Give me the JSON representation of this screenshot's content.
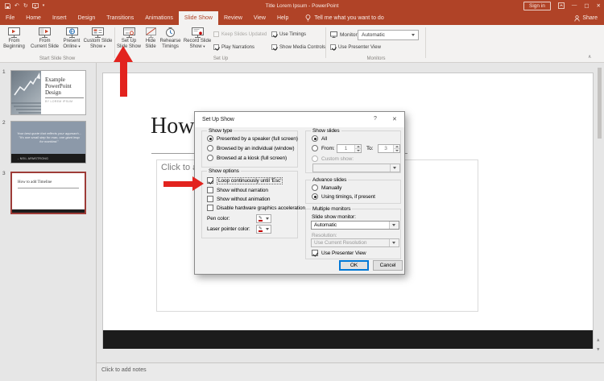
{
  "colors": {
    "brand": "#B04327",
    "annotation_arrow": "#E2231E",
    "focus_blue": "#0078D7",
    "selected_thumb_border": "#9E3C38"
  },
  "icons": {
    "dropdown_caret": "▾",
    "undo": "↶",
    "redo": "↻",
    "collapse_ribbon": "∧",
    "minimize": "—",
    "maximize": "□",
    "close": "✕",
    "pen": "✎",
    "scroll_up": "▲",
    "scroll_down": "▼"
  },
  "titlebar": {
    "title": "Title Lorem Ipsum  -  PowerPoint",
    "sign_in_label": "Sign in"
  },
  "menubar": {
    "tabs": [
      "File",
      "Home",
      "Insert",
      "Design",
      "Transitions",
      "Animations",
      "Slide Show",
      "Review",
      "View",
      "Help"
    ],
    "active_tab": "Slide Show",
    "tell_me": "Tell me what you want to do",
    "share_label": "Share"
  },
  "ribbon": {
    "start_group": {
      "label": "Start Slide Show",
      "from_beginning": {
        "line1": "From",
        "line2": "Beginning"
      },
      "from_current": {
        "line1": "From",
        "line2": "Current Slide"
      },
      "present_online": {
        "line1": "Present",
        "line2": "Online"
      },
      "custom_show": {
        "line1": "Custom Slide",
        "line2": "Show"
      }
    },
    "setup_group": {
      "label": "Set Up",
      "setup_slideshow": {
        "line1": "Set Up",
        "line2": "Slide Show"
      },
      "hide_slide": {
        "line1": "Hide",
        "line2": "Slide"
      },
      "rehearse": {
        "line1": "Rehearse",
        "line2": "Timings"
      },
      "record": {
        "line1": "Record Slide",
        "line2": "Show"
      },
      "checkboxes": [
        {
          "label": "Keep Slides Updated",
          "checked": false,
          "disabled": true
        },
        {
          "label": "Play Narrations",
          "checked": true,
          "disabled": false
        },
        {
          "label": "Use Timings",
          "checked": true,
          "disabled": false
        },
        {
          "label": "Show Media Controls",
          "checked": true,
          "disabled": false
        }
      ]
    },
    "monitors_group": {
      "label": "Monitors",
      "monitor_label": "Monitor:",
      "monitor_value": "Automatic",
      "use_presenter_view": "Use Presenter View",
      "presenter_checked": true
    }
  },
  "slides_panel": {
    "slides": [
      {
        "number": "1",
        "line1": "Example",
        "line2": "PowerPoint",
        "line3": "Design",
        "byline": "BY LOREM IPSUM"
      },
      {
        "number": "2",
        "quote": "Your best quote that reflects your approach... \"It's one small step for man, one giant leap for mankind.\"",
        "attribution": "- NEIL ARMSTRONG"
      },
      {
        "number": "3",
        "title": "How to add Timeline",
        "selected": true
      }
    ]
  },
  "canvas": {
    "slide_title": "How to add Timeline",
    "body_placeholder": "Click to add text",
    "notes_placeholder": "Click to add notes"
  },
  "dialog": {
    "title": "Set Up Show",
    "help": "?",
    "close": "✕",
    "show_type": {
      "label": "Show type",
      "opt1": "Presented by a speaker (full screen)",
      "opt2": "Browsed by an individual (window)",
      "opt3": "Browsed at a kiosk (full screen)",
      "selected": "opt1"
    },
    "show_options": {
      "label": "Show options",
      "cb1": "Loop continuously until 'Esc'",
      "cb1_checked": true,
      "cb2": "Show without narration",
      "cb3": "Show without animation",
      "cb4": "Disable hardware graphics acceleration",
      "pen_label": "Pen color:",
      "laser_label": "Laser pointer color:"
    },
    "show_slides": {
      "label": "Show slides",
      "all_label": "All",
      "selected": "all",
      "from_label": "From:",
      "from_value": "1",
      "to_label": "To:",
      "to_value": "3",
      "custom_label": "Custom show:"
    },
    "advance": {
      "label": "Advance slides",
      "opt1": "Manually",
      "opt2": "Using timings, if present",
      "selected": "opt2"
    },
    "monitors": {
      "label": "Multiple monitors",
      "monitor_label": "Slide show monitor:",
      "monitor_value": "Automatic",
      "resolution_label": "Resolution:",
      "resolution_value": "Use Current Resolution",
      "presenter_label": "Use Presenter View",
      "presenter_checked": true
    },
    "ok_label": "OK",
    "cancel_label": "Cancel"
  }
}
